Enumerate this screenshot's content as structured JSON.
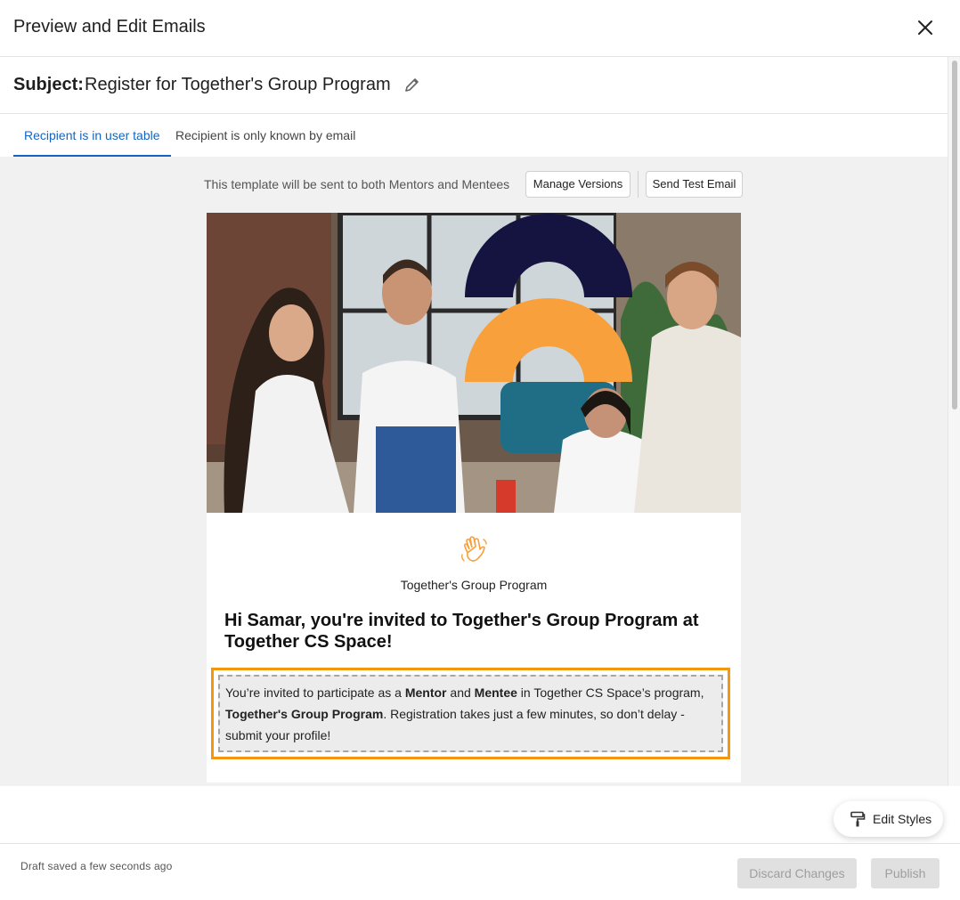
{
  "header": {
    "title": "Preview and Edit Emails"
  },
  "subject": {
    "label": "Subject:",
    "text": "Register for Together's Group Program"
  },
  "tabs": [
    {
      "label": "Recipient is in user table",
      "active": true
    },
    {
      "label": "Recipient is only known by email",
      "active": false
    }
  ],
  "toolbar": {
    "info_text": "This template will be sent to both Mentors and Mentees",
    "manage_versions_label": "Manage Versions",
    "send_test_label": "Send Test Email"
  },
  "email": {
    "program_name": "Together's Group Program",
    "heading": "Hi Samar, you're invited to Together's Group Program at Together CS Space!",
    "body": {
      "p1": "You’re invited to participate as a ",
      "role1": "Mentor",
      "p2": " and ",
      "role2": "Mentee",
      "p3": " in Together CS Space’s program, ",
      "program": "Together's Group Program",
      "p4": ". Registration takes just a few minutes, so don’t delay - submit your profile!"
    }
  },
  "edit_styles_label": "Edit Styles",
  "footer": {
    "draft_status": "Draft saved a few seconds ago",
    "discard_label": "Discard Changes",
    "publish_label": "Publish"
  },
  "colors": {
    "accent_blue": "#1565c0",
    "highlight_orange": "#f5960f",
    "arch_navy": "#15133f",
    "arch_orange": "#f7a03c"
  }
}
